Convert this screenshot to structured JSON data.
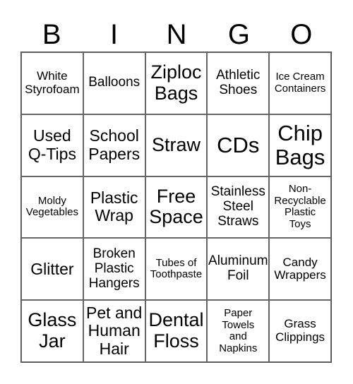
{
  "header": [
    "B",
    "I",
    "N",
    "G",
    "O"
  ],
  "cells": [
    [
      "White\nStyrofoam",
      "Balloons",
      "Ziploc\nBags",
      "Athletic\nShoes",
      "Ice Cream\nContainers"
    ],
    [
      "Used\nQ-Tips",
      "School\nPapers",
      "Straw",
      "CDs",
      "Chip\nBags"
    ],
    [
      "Moldy\nVegetables",
      "Plastic\nWrap",
      "Free\nSpace",
      "Stainless\nSteel\nStraws",
      "Non-\nRecyclable\nPlastic\nToys"
    ],
    [
      "Glitter",
      "Broken\nPlastic\nHangers",
      "Tubes of\nToothpaste",
      "Aluminum\nFoil",
      "Candy\nWrappers"
    ],
    [
      "Glass\nJar",
      "Pet and\nHuman\nHair",
      "Dental\nFloss",
      "Paper\nTowels\nand\nNapkins",
      "Grass\nClippings"
    ]
  ]
}
